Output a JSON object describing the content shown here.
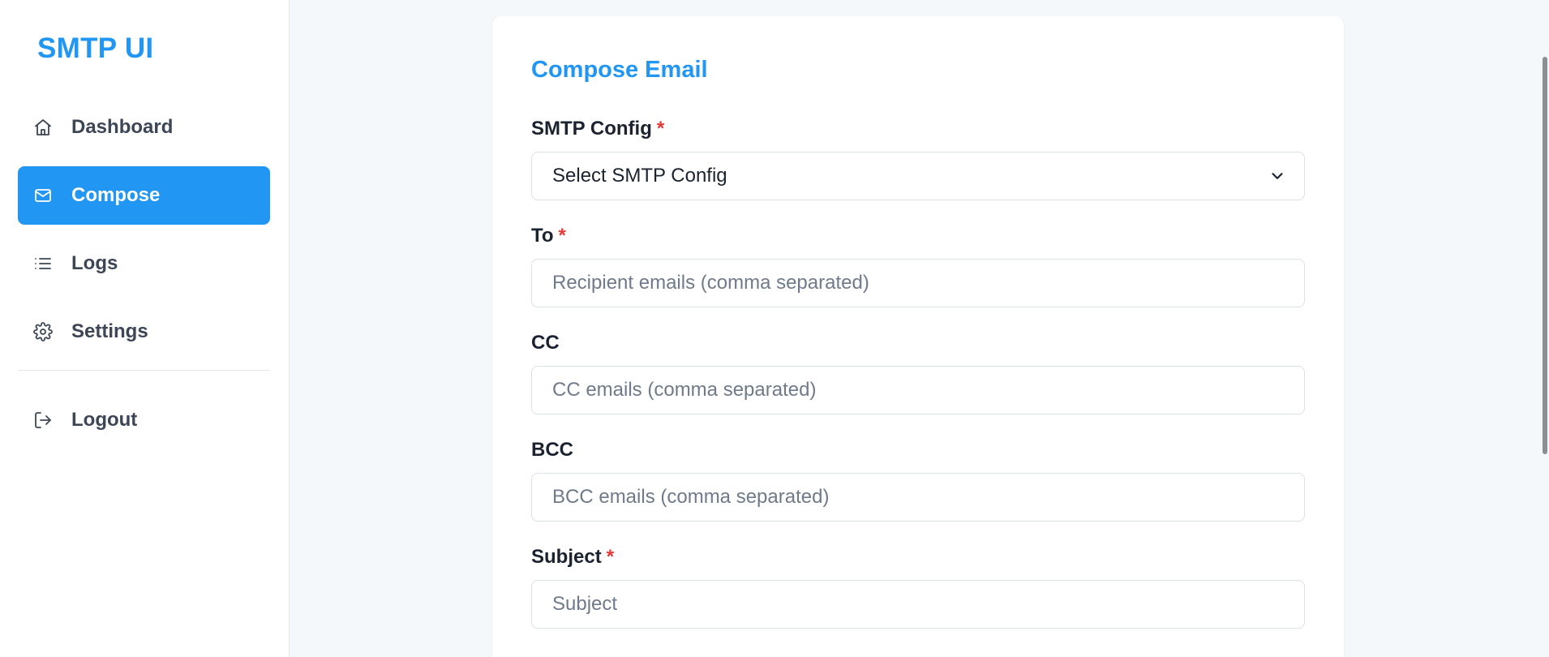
{
  "brand": {
    "name": "SMTP UI",
    "color": "#2196f3"
  },
  "sidebar": {
    "items": [
      {
        "label": "Dashboard",
        "icon": "home-icon",
        "active": false
      },
      {
        "label": "Compose",
        "icon": "mail-icon",
        "active": true
      },
      {
        "label": "Logs",
        "icon": "list-icon",
        "active": false
      },
      {
        "label": "Settings",
        "icon": "gear-icon",
        "active": false
      }
    ],
    "logout": {
      "label": "Logout",
      "icon": "logout-icon"
    }
  },
  "compose": {
    "title": "Compose Email",
    "required_marker": "*",
    "fields": {
      "smtp_config": {
        "label": "SMTP Config",
        "required": true,
        "selected": "Select SMTP Config"
      },
      "to": {
        "label": "To",
        "required": true,
        "placeholder": "Recipient emails (comma separated)",
        "value": ""
      },
      "cc": {
        "label": "CC",
        "required": false,
        "placeholder": "CC emails (comma separated)",
        "value": ""
      },
      "bcc": {
        "label": "BCC",
        "required": false,
        "placeholder": "BCC emails (comma separated)",
        "value": ""
      },
      "subject": {
        "label": "Subject",
        "required": true,
        "placeholder": "Subject",
        "value": ""
      }
    }
  },
  "colors": {
    "accent": "#2196f3",
    "required": "#e53935",
    "background": "#f5f8fb"
  }
}
